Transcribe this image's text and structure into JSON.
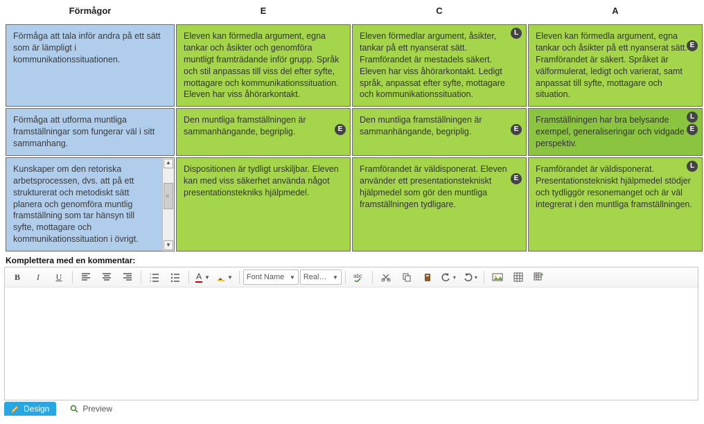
{
  "headers": {
    "abilities": "Förmågor",
    "e": "E",
    "c": "C",
    "a": "A"
  },
  "rows": [
    {
      "ability": "Förmåga att tala inför andra på ett sätt som är lämpligt i kommunikationssituationen.",
      "e": {
        "text": "Eleven kan förmedla argument, egna tankar och åsikter och genomföra muntligt framträdande inför grupp. Språk och stil anpassas till viss del efter syfte, mottagare och kommunikationssituation. Eleven har viss åhörarkontakt.",
        "badges": []
      },
      "c": {
        "text": "Eleven förmedlar argument, åsikter, tankar på ett nyanserat sätt. Framförandet är mestadels säkert. Eleven har viss åhörarkontakt. Ledigt språk, anpassat efter syfte, mottagare och kommunikationssituation.",
        "badges": [
          {
            "label": "L",
            "pos": "tr"
          }
        ]
      },
      "a": {
        "text": "Eleven kan förmedla argument, egna tankar och åsikter på ett nyanserat sätt. Framförandet är säkert. Språket är välformulerat, ledigt och varierat, samt anpassat till syfte, mottagare och situation.",
        "badges": [
          {
            "label": "E",
            "pos": "mr"
          }
        ]
      }
    },
    {
      "ability": "Förmåga att utforma muntliga framställningar som fungerar väl i sitt sammanhang.",
      "e": {
        "text": "Den muntliga framställningen är sammanhängande, begriplig.",
        "badges": [
          {
            "label": "E",
            "pos": "mr"
          }
        ]
      },
      "c": {
        "text": "Den muntliga framställningen är sammanhängande, begriplig.",
        "badges": [
          {
            "label": "E",
            "pos": "mr"
          }
        ]
      },
      "a": {
        "text": "Framställningen har bra belysande exempel, generaliseringar och vidgade perspektiv.",
        "dark": true,
        "badges": [
          {
            "label": "L",
            "pos": "tr"
          },
          {
            "label": "E",
            "pos": "mr"
          }
        ]
      }
    },
    {
      "ability": "Kunskaper om den retoriska arbetsprocessen, dvs. att på ett strukturerat och metodiskt sätt planera och genomföra muntlig framställning som tar hänsyn till syfte, mottagare och kommunikationssituation i övrigt.",
      "ability_scroll": true,
      "e": {
        "text": "Dispositionen är tydligt urskiljbar. Eleven kan med viss säkerhet använda något presentationstekniks hjälpmedel.",
        "badges": []
      },
      "c": {
        "text": "Framförandet är väldisponerat. Eleven använder ett presentationstekniskt hjälpmedel som gör den muntliga framställningen tydligare.",
        "badges": [
          {
            "label": "E",
            "pos": "mr"
          }
        ]
      },
      "a": {
        "text": "Framförandet är väldisponerat. Presentationstekniskt hjälpmedel stödjer och tydliggör resonemanget och är väl integrerat i den muntliga framställningen.",
        "badges": [
          {
            "label": "L",
            "pos": "tr"
          }
        ]
      }
    }
  ],
  "comment_label": "Komplettera med en kommentar:",
  "toolbar": {
    "bold": "B",
    "italic": "I",
    "underline": "U",
    "font_name": "Font Name",
    "font_size": "Real…",
    "font_color_letter": "A"
  },
  "footer": {
    "design": "Design",
    "preview": "Preview"
  }
}
